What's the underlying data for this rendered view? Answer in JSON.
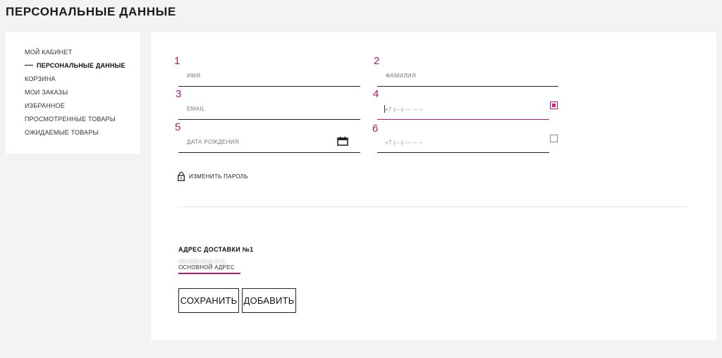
{
  "page": {
    "title": "ПЕРСОНАЛЬНЫЕ ДАННЫЕ"
  },
  "sidebar": {
    "items": [
      {
        "label": "МОЙ КАБИНЕТ",
        "active": false
      },
      {
        "label": "ПЕРСОНАЛЬНЫЕ ДАННЫЕ",
        "active": true
      },
      {
        "label": "КОРЗИНА",
        "active": false
      },
      {
        "label": "МОИ ЗАКАЗЫ",
        "active": false
      },
      {
        "label": "ИЗБРАННОЕ",
        "active": false
      },
      {
        "label": "ПРОСМОТРЕННЫЕ ТОВАРЫ",
        "active": false
      },
      {
        "label": "ОЖИДАЕМЫЕ ТОВАРЫ",
        "active": false
      }
    ]
  },
  "form": {
    "markers": [
      "1",
      "2",
      "3",
      "4",
      "5",
      "6"
    ],
    "first_name": {
      "placeholder": "ИМЯ",
      "value": ""
    },
    "last_name": {
      "placeholder": "ФАМИЛИЯ",
      "value": ""
    },
    "email": {
      "placeholder": "EMAIL",
      "value": ""
    },
    "phone1": {
      "placeholder": "+7 (---) --- -- --",
      "value": "",
      "checked": true
    },
    "birth_date": {
      "placeholder": "ДАТА РОЖДЕНИЯ",
      "value": "",
      "icon": "calendar-icon"
    },
    "phone2": {
      "placeholder": "+7 (---) --- -- --",
      "value": "",
      "checked": false
    },
    "change_password": {
      "label": "ИЗМЕНИТЬ ПАРОЛЬ",
      "icon": "lock-icon"
    }
  },
  "address": {
    "title": "АДРЕС ДОСТАВКИ №1",
    "blurred_text": "ххх ххххх ул.хх хх хх",
    "main_label": "ОСНОВНОЙ АДРЕС"
  },
  "buttons": {
    "save": "СОХРАНИТЬ",
    "add": "ДОБАВИТЬ"
  },
  "colors": {
    "accent": "#c2187a",
    "background": "#f4f2f5",
    "card": "#ffffff"
  }
}
